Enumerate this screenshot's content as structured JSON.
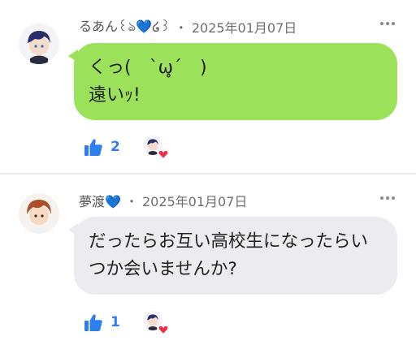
{
  "comments": [
    {
      "author": "るあん꒰ঌ💙໒꒱",
      "dot": "・",
      "date": "2025年01月07日",
      "text_lines": [
        "くっ(　`ω̥´　)",
        "遠いｯ!"
      ],
      "likes": "2",
      "bubble_color": "#9be25a"
    },
    {
      "author": "夢渡💙",
      "dot": "・",
      "date": "2025年01月07日",
      "text_lines": [
        "だったらお互い高校生になったらい",
        "つか会いませんか?"
      ],
      "likes": "1",
      "bubble_color": "#ececf0"
    }
  ],
  "icons": {
    "like": "thumbs-up-icon",
    "more": "more-dots-icon",
    "reaction": "heart-icon"
  },
  "colors": {
    "accent": "#2d7ff0",
    "heart": "#e8344a"
  }
}
